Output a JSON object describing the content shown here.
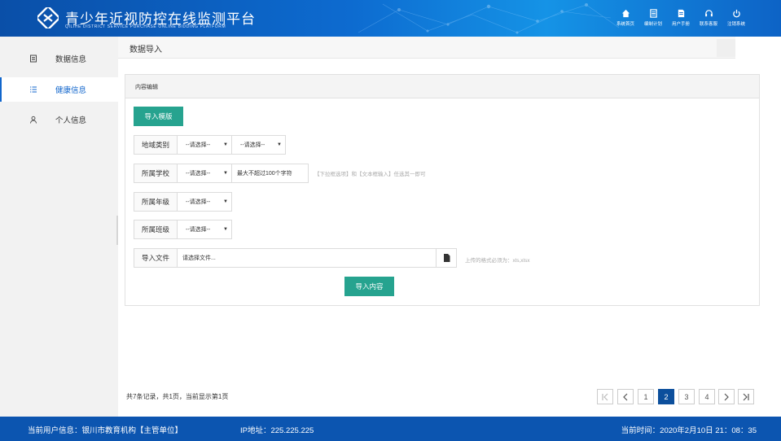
{
  "header": {
    "title": "青少年近视防控在线监测平台",
    "subtitle": "QILIHE DISTRICT SERVICE PURCHASE ONLINE BIDDING PLATFORM",
    "nav": [
      {
        "label": "系统首页",
        "icon": "home-icon"
      },
      {
        "label": "编制计划",
        "icon": "plan-icon"
      },
      {
        "label": "用户手册",
        "icon": "manual-icon"
      },
      {
        "label": "联系客服",
        "icon": "headset-icon"
      },
      {
        "label": "注销系统",
        "icon": "power-icon"
      }
    ]
  },
  "sidebar": {
    "items": [
      {
        "label": "数据信息",
        "icon": "document-icon",
        "active": false
      },
      {
        "label": "健康信息",
        "icon": "list-icon",
        "active": true
      },
      {
        "label": "个人信息",
        "icon": "user-icon",
        "active": false
      }
    ]
  },
  "breadcrumb": {
    "title": "数据导入"
  },
  "panel": {
    "title": "内容编辑",
    "import_template_label": "导入模版",
    "region": {
      "label": "地域类别",
      "select1": "--请选择--",
      "select2": "--请选择--"
    },
    "school": {
      "label": "所属学校",
      "select": "--请选择--",
      "placeholder": "最大不超过100个字符",
      "hint": "【下拉框选项】和【文本框输入】任选其一即可"
    },
    "grade": {
      "label": "所属年级",
      "select": "--请选择--"
    },
    "class": {
      "label": "所属班级",
      "select": "--请选择--"
    },
    "file": {
      "label": "导入文件",
      "placeholder": "请选择文件...",
      "hint": "上传的格式必须为：xls,xlsx"
    },
    "import_content_label": "导入内容"
  },
  "records": "共7条记录，共1页，当前显示第1页",
  "pagination": {
    "pages": [
      "1",
      "2",
      "3",
      "4"
    ],
    "current": "2"
  },
  "footer": {
    "user": "当前用户信息：银川市教育机构【主管单位】",
    "ip": "IP地址：225.225.225",
    "time": "当前时间：2020年2月10日 21：08：35"
  },
  "colors": {
    "header": "#0d6bd0",
    "accent": "#26a38f",
    "footer": "#0c55b0",
    "active": "#1166cc"
  }
}
